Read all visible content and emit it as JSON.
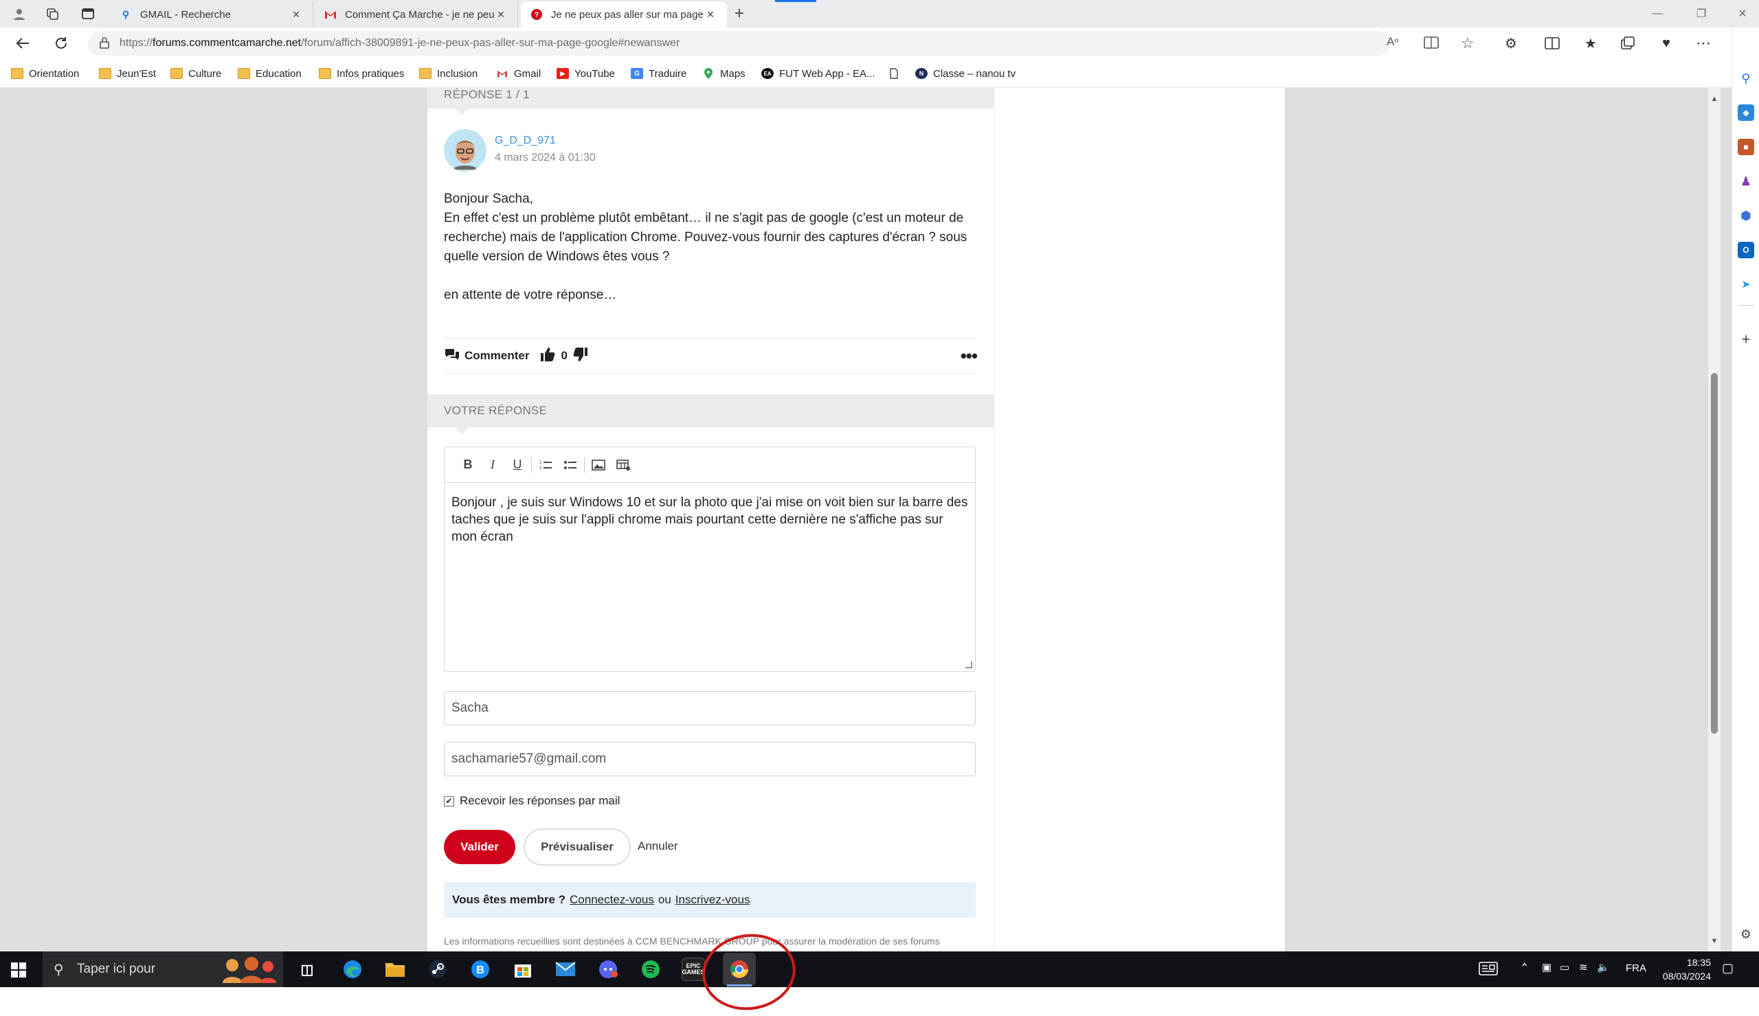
{
  "tabs": [
    {
      "title": "GMAIL - Recherche",
      "icon": "search-icon"
    },
    {
      "title": "Comment Ça Marche - je ne peu",
      "icon": "gmail-icon"
    },
    {
      "title": "Je ne peux pas aller sur ma page",
      "icon": "ccm-icon"
    }
  ],
  "address": {
    "scheme": "https://",
    "host": "forums.commentcamarche.net",
    "path": "/forum/affich-38009891-je-ne-peux-pas-aller-sur-ma-page-google#newanswer"
  },
  "bookmarks": [
    "Orientation",
    "Jeun'Est",
    "Culture",
    "Education",
    "Infos pratiques",
    "Inclusion",
    "Gmail",
    "YouTube",
    "Traduire",
    "Maps",
    "FUT Web App - EA...",
    "Classe – nanou tv"
  ],
  "post": {
    "section_title": "RÉPONSE 1 / 1",
    "author": "G_D_D_971",
    "date": "4 mars 2024 à 01:30",
    "lines": [
      "Bonjour Sacha,",
      "En effet c'est un problème plutôt embêtant… il ne s'agit pas de google (c'est un moteur de recherche) mais de l'application Chrome. Pouvez-vous fournir des captures d'écran ? sous quelle version de Windows êtes vous ?",
      "en attente de votre réponse…"
    ],
    "comment_label": "Commenter",
    "likes": "0"
  },
  "reply": {
    "section_title": "VOTRE RÉPONSE",
    "text": "Bonjour , je suis sur Windows 10 et sur la photo que j'ai mise on voit bien sur la barre des taches que je suis sur l'appli chrome mais pourtant cette dernière ne s'affiche pas sur mon écran",
    "name": "Sacha",
    "email": "sachamarie57@gmail.com",
    "mail_option": "Recevoir les réponses par mail",
    "validate": "Valider",
    "preview": "Prévisualiser",
    "cancel": "Annuler",
    "member_q": "Vous êtes membre ?",
    "login": "Connectez-vous",
    "or": "ou",
    "signup": "Inscrivez-vous",
    "notice": "Les informations recueillies sont destinées à CCM BENCHMARK GROUP pour assurer la modération de ses forums"
  },
  "taskbar": {
    "search_placeholder": "Taper ici pour",
    "lang": "FRA",
    "time": "18:35",
    "date": "08/03/2024"
  },
  "colors": {
    "accent": "#d0021b",
    "link": "#3c8fd3",
    "annotation": "#cc1a1a"
  }
}
